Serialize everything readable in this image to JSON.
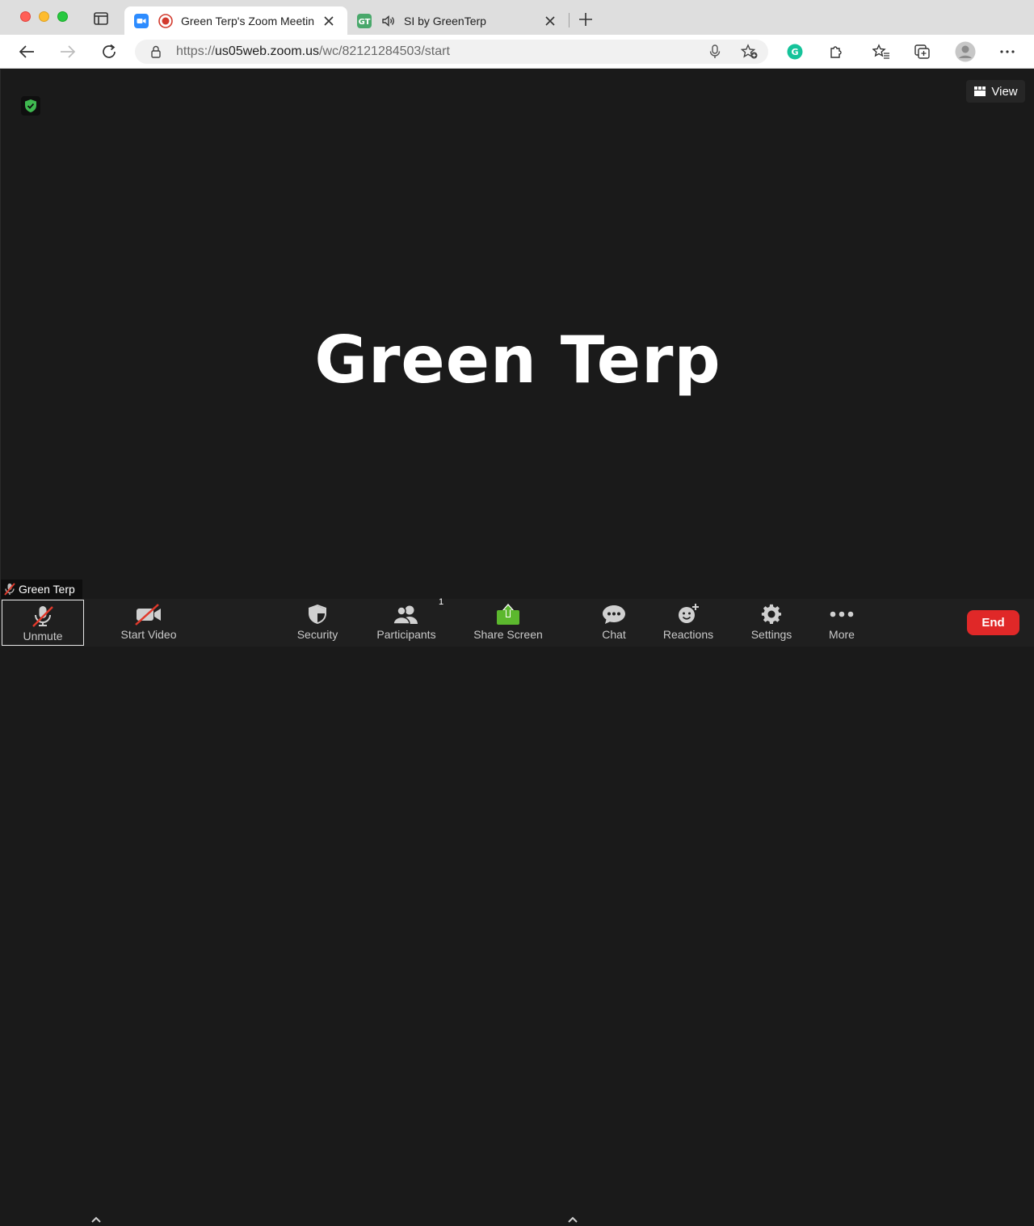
{
  "browser": {
    "tabs": [
      {
        "title": "Green Terp's Zoom Meetin",
        "active": true
      },
      {
        "title": "SI by GreenTerp",
        "active": false
      }
    ],
    "address": {
      "scheme": "https://",
      "host": "us05web.zoom.us",
      "path": "/wc/82121284503/start"
    }
  },
  "meeting": {
    "participant_display": "Green Terp",
    "name_tag": "Green Terp",
    "view_label": "View"
  },
  "controls": {
    "unmute": "Unmute",
    "start_video": "Start Video",
    "security": "Security",
    "participants": "Participants",
    "participants_count": "1",
    "share_screen": "Share Screen",
    "chat": "Chat",
    "reactions": "Reactions",
    "settings": "Settings",
    "more": "More",
    "end": "End"
  },
  "colors": {
    "meeting_bg": "#1a1a1a",
    "share_green": "#5cb82e",
    "end_red": "#e02828",
    "mute_slash": "#e0392b",
    "shield_green": "#3fb950"
  }
}
